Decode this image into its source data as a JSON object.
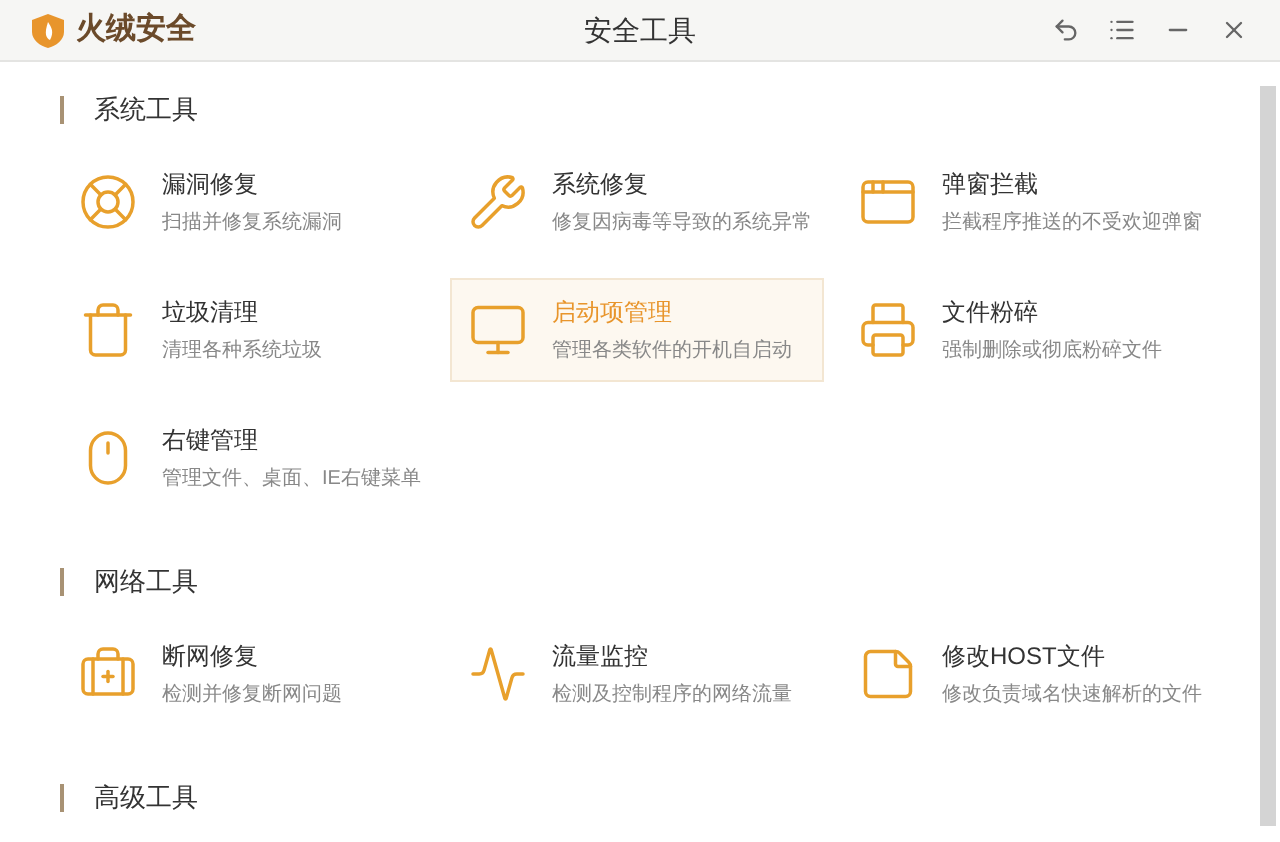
{
  "window": {
    "brand": "火绒安全",
    "title": "安全工具"
  },
  "sections": [
    {
      "heading": "系统工具",
      "items": [
        {
          "title": "漏洞修复",
          "desc": "扫描并修复系统漏洞",
          "selected": false
        },
        {
          "title": "系统修复",
          "desc": "修复因病毒等导致的系统异常",
          "selected": false
        },
        {
          "title": "弹窗拦截",
          "desc": "拦截程序推送的不受欢迎弹窗",
          "selected": false
        },
        {
          "title": "垃圾清理",
          "desc": "清理各种系统垃圾",
          "selected": false
        },
        {
          "title": "启动项管理",
          "desc": "管理各类软件的开机自启动",
          "selected": true
        },
        {
          "title": "文件粉碎",
          "desc": "强制删除或彻底粉碎文件",
          "selected": false
        },
        {
          "title": "右键管理",
          "desc": "管理文件、桌面、IE右键菜单",
          "selected": false
        }
      ]
    },
    {
      "heading": "网络工具",
      "items": [
        {
          "title": "断网修复",
          "desc": "检测并修复断网问题",
          "selected": false
        },
        {
          "title": "流量监控",
          "desc": "检测及控制程序的网络流量",
          "selected": false
        },
        {
          "title": "修改HOST文件",
          "desc": "修改负责域名快速解析的文件",
          "selected": false
        }
      ]
    },
    {
      "heading": "高级工具"
    }
  ]
}
